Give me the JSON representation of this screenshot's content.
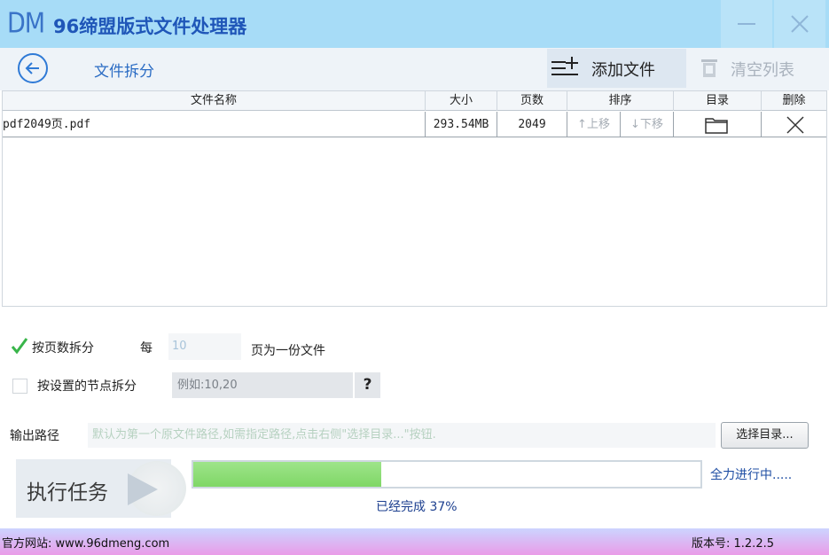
{
  "window": {
    "logo": "DM",
    "title": "96缔盟版式文件处理器"
  },
  "toolbar": {
    "section_title": "文件拆分",
    "add_file": "添加文件",
    "clear_list": "清空列表"
  },
  "table": {
    "headers": [
      "文件名称",
      "大小",
      "页数",
      "排序",
      "目录",
      "删除"
    ],
    "rows": [
      {
        "name": "pdf2049页.pdf",
        "size": "293.54MB",
        "pages": "2049",
        "move_up": "↑上移",
        "move_down": "↓下移"
      }
    ]
  },
  "options": {
    "by_pages_label": "按页数拆分",
    "by_pages_checked": true,
    "each_label": "每",
    "pages_placeholder": "10",
    "pages_suffix": "页为一份文件",
    "by_nodes_label": "按设置的节点拆分",
    "by_nodes_checked": false,
    "nodes_placeholder": "例如:10,20",
    "help_label": "?"
  },
  "output": {
    "label": "输出路径",
    "placeholder": "默认为第一个原文件路径,如需指定路径,点击右侧\"选择目录...\"按钮.",
    "browse_label": "选择目录..."
  },
  "task": {
    "run_label": "执行任务",
    "progress_percent": 37,
    "status": "全力进行中.....",
    "progress_text": "已经完成 37%"
  },
  "footer": {
    "site": "官方网站:  www.96dmeng.com",
    "version": "版本号: 1.2.2.5"
  },
  "colors": {
    "titlebar": "#a7dcf7",
    "accent": "#2b6cc4",
    "progress": "#7fd766"
  }
}
